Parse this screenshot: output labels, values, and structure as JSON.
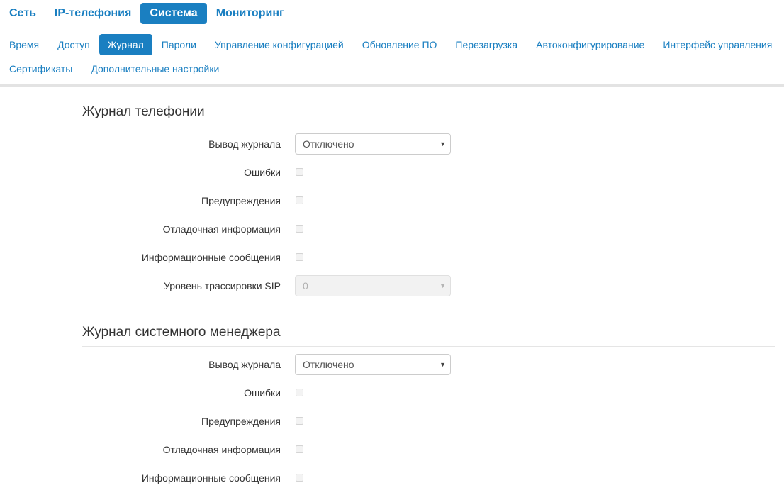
{
  "top_nav": {
    "tabs": [
      {
        "label": "Сеть",
        "active": false
      },
      {
        "label": "IP-телефония",
        "active": false
      },
      {
        "label": "Система",
        "active": true
      },
      {
        "label": "Мониторинг",
        "active": false
      }
    ]
  },
  "sub_nav": {
    "row1": [
      {
        "label": "Время",
        "active": false
      },
      {
        "label": "Доступ",
        "active": false
      },
      {
        "label": "Журнал",
        "active": true
      },
      {
        "label": "Пароли",
        "active": false
      },
      {
        "label": "Управление конфигурацией",
        "active": false
      },
      {
        "label": "Обновление ПО",
        "active": false
      },
      {
        "label": "Перезагрузка",
        "active": false
      },
      {
        "label": "Автоконфигурирование",
        "active": false
      },
      {
        "label": "Интерфейс управления",
        "active": false
      }
    ],
    "row2": [
      {
        "label": "Сертификаты",
        "active": false
      },
      {
        "label": "Дополнительные настройки",
        "active": false
      }
    ]
  },
  "telephony_log": {
    "title": "Журнал телефонии",
    "output_label": "Вывод журнала",
    "output_value": "Отключено",
    "errors_label": "Ошибки",
    "warnings_label": "Предупреждения",
    "debug_label": "Отладочная информация",
    "info_label": "Информационные сообщения",
    "sip_trace_label": "Уровень трассировки SIP",
    "sip_trace_value": "0"
  },
  "system_manager_log": {
    "title": "Журнал системного менеджера",
    "output_label": "Вывод журнала",
    "output_value": "Отключено",
    "errors_label": "Ошибки",
    "warnings_label": "Предупреждения",
    "debug_label": "Отладочная информация",
    "info_label": "Информационные сообщения"
  },
  "icons": {
    "caret": "▼"
  },
  "colors": {
    "accent": "#1a7fc1",
    "text": "#333333",
    "divider": "#e3e3e3"
  }
}
